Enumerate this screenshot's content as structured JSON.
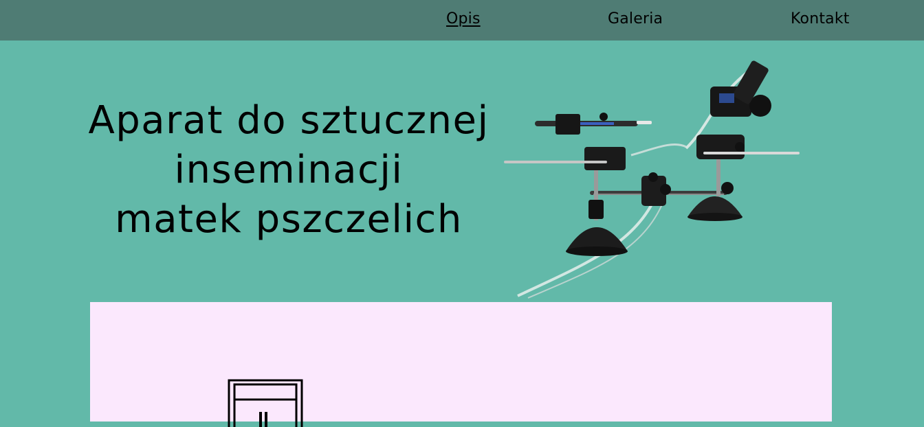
{
  "nav": {
    "items": [
      {
        "label": "Opis",
        "active": true
      },
      {
        "label": "Galeria",
        "active": false
      },
      {
        "label": "Kontakt",
        "active": false
      }
    ]
  },
  "hero": {
    "title_lines": [
      "Aparat do sztucznej",
      "inseminacji",
      "matek pszczelich"
    ]
  },
  "colors": {
    "navbar_bg": "#4f7c74",
    "page_bg": "#62b9a9",
    "panel_bg": "#fbe8fd",
    "text": "#000000"
  },
  "icons": {
    "hero_image": "insemination-apparatus-photo",
    "panel_image": "line-drawing-frame-icon"
  }
}
